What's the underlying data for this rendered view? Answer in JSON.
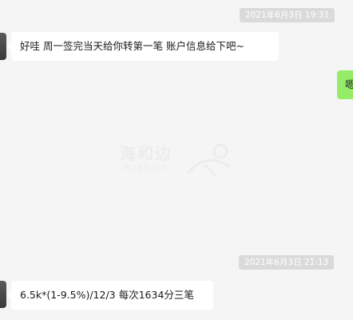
{
  "timestamps": [
    {
      "text": "2021年6月3日 19:31"
    },
    {
      "text": "2021年6月3日 21:13"
    }
  ],
  "messages": [
    {
      "direction": "incoming",
      "text": "好哇 周一签完当天给你转第一笔 账户信息给下吧~"
    },
    {
      "direction": "outgoing",
      "text": "嗯"
    },
    {
      "direction": "incoming",
      "text": "6.5k*(1-9.5%)/12/3 每次1634分三笔"
    }
  ],
  "watermark": {
    "text_cn": "海和边",
    "text_en": "Huabian"
  },
  "colors": {
    "background": "#f5f5f5",
    "incoming_bubble": "#ffffff",
    "outgoing_bubble": "#95ec69",
    "timestamp_bg": "#dadada"
  }
}
